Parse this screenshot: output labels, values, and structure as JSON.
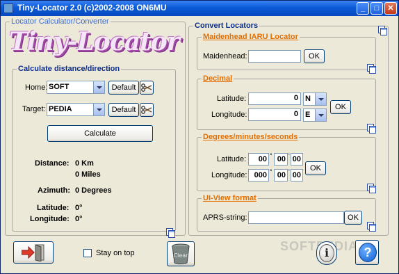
{
  "window": {
    "title": "Tiny-Locator 2.0 (c)2002-2008 ON6MU",
    "min": "_",
    "max": "□",
    "close": "✕"
  },
  "left": {
    "group_title": "Locator Calculator/Converter",
    "logo_text": "Tiny-Locator",
    "calc": {
      "legend": "Calculate distance/direction",
      "home_label": "Home:",
      "home_value": "SOFT",
      "target_label": "Target:",
      "target_value": "PEDIA",
      "default_label": "Default",
      "calculate_label": "Calculate",
      "distance_label": "Distance:",
      "distance_km": "0 Km",
      "distance_miles": "0 Miles",
      "azimuth_label": "Azimuth:",
      "azimuth_value": "0 Degrees",
      "latitude_label": "Latitude:",
      "latitude_value": "0°",
      "longitude_label": "Longitude:",
      "longitude_value": "0°"
    }
  },
  "right": {
    "group_title": "Convert Locators",
    "maidenhead": {
      "legend": "Maidenhead IARU Locator",
      "label": "Maidenhead:",
      "value": "",
      "ok": "OK"
    },
    "decimal": {
      "legend": "Decimal",
      "lat_label": "Latitude:",
      "lat_value": "0",
      "lat_dir": "N",
      "lon_label": "Longitude:",
      "lon_value": "0",
      "lon_dir": "E",
      "ok": "OK"
    },
    "dms": {
      "legend": "Degrees/minutes/seconds",
      "lat_label": "Latitude:",
      "lat_deg": "00",
      "lat_min": "00",
      "lat_sec": "00",
      "lon_label": "Longitude:",
      "lon_deg": "000",
      "lon_min": "00",
      "lon_sec": "00",
      "ok": "OK",
      "deg_sym": "°",
      "min_sym": "'",
      "sec_sym": "\""
    },
    "uiview": {
      "legend": "UI-View format",
      "label": "APRS-string:",
      "value": "",
      "ok": "OK"
    }
  },
  "bottom": {
    "stay_on_top": "Stay on top",
    "stay_on_top_checked": false,
    "clear_label": "Clear",
    "info_label": "i",
    "help_label": "?",
    "watermark": "SOFTPEDIA"
  },
  "icons": [
    "app-icon",
    "exit-door-icon",
    "recycle-bin-icon",
    "info-icon",
    "help-icon",
    "copy-icon",
    "scissors-icon",
    "dropdown-arrow-icon"
  ]
}
